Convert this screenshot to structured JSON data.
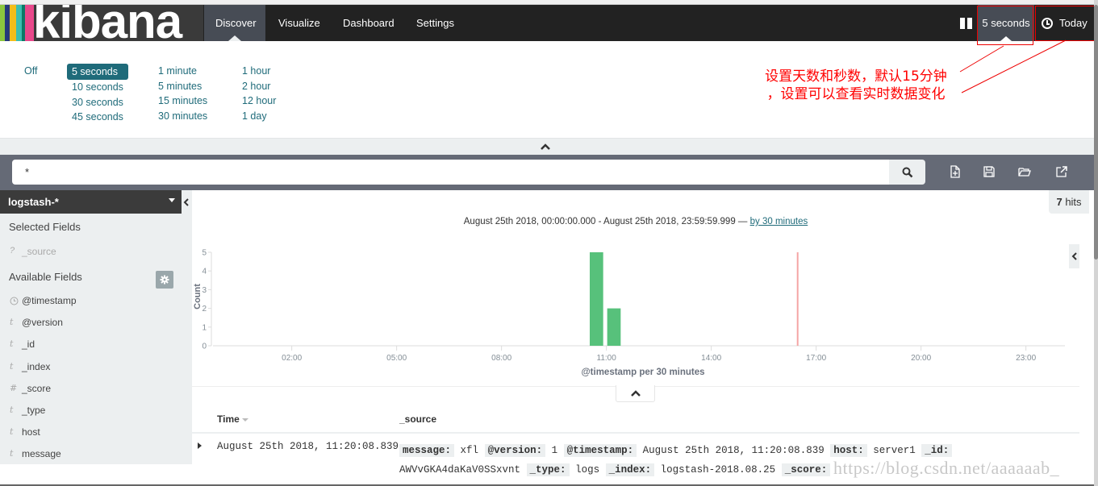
{
  "app": {
    "logo_text": "kibana",
    "logo_stripe_colors": [
      "#8cc63e",
      "#25387b",
      "#f4bd19",
      "#3cbeb1",
      "#0c7a66",
      "#e8488b"
    ]
  },
  "nav": {
    "items": [
      {
        "label": "Discover",
        "active": true
      },
      {
        "label": "Visualize",
        "active": false
      },
      {
        "label": "Dashboard",
        "active": false
      },
      {
        "label": "Settings",
        "active": false
      }
    ],
    "refresh_interval_label": "5 seconds",
    "timepicker_label": "Today"
  },
  "refresh_panel": {
    "columns": [
      [
        "Off"
      ],
      [
        "5 seconds",
        "10 seconds",
        "30 seconds",
        "45 seconds"
      ],
      [
        "1 minute",
        "5 minutes",
        "15 minutes",
        "30 minutes"
      ],
      [
        "1 hour",
        "2 hour",
        "12 hour",
        "1 day"
      ]
    ],
    "selected": "5 seconds"
  },
  "annotation": {
    "line1": "设置天数和秒数，默认15分钟",
    "line2": "，设置可以查看实时数据变化",
    "color": "#ff0000"
  },
  "search": {
    "query": "*"
  },
  "toolbar": {
    "icons": [
      "new-document-icon",
      "save-icon",
      "open-folder-icon",
      "share-icon"
    ]
  },
  "sidebar": {
    "index_pattern": "logstash-*",
    "selected_fields_title": "Selected Fields",
    "selected_fields": [
      {
        "type": "?",
        "name": "_source"
      }
    ],
    "available_fields_title": "Available Fields",
    "available_fields": [
      {
        "type": "clock",
        "name": "@timestamp"
      },
      {
        "type": "t",
        "name": "@version"
      },
      {
        "type": "t",
        "name": "_id"
      },
      {
        "type": "t",
        "name": "_index"
      },
      {
        "type": "#",
        "name": "_score"
      },
      {
        "type": "t",
        "name": "_type"
      },
      {
        "type": "t",
        "name": "host"
      },
      {
        "type": "t",
        "name": "message"
      }
    ]
  },
  "hits": {
    "count": "7",
    "label": "hits"
  },
  "time_range": {
    "text": "August 25th 2018, 00:00:00.000 - August 25th 2018, 23:59:59.999 — ",
    "interval_link": "by 30 minutes"
  },
  "chart_data": {
    "type": "bar",
    "title": "",
    "xlabel": "@timestamp per 30 minutes",
    "ylabel": "Count",
    "x_unit": "hours",
    "xlim": [
      0,
      24
    ],
    "ylim": [
      0,
      5
    ],
    "x_ticks": [
      2,
      5,
      8,
      11,
      14,
      17,
      20,
      23
    ],
    "x_tick_labels": [
      "02:00",
      "05:00",
      "08:00",
      "11:00",
      "14:00",
      "17:00",
      "20:00",
      "23:00"
    ],
    "y_ticks": [
      0,
      1,
      2,
      3,
      4,
      5
    ],
    "bucket_hours": 0.5,
    "bars": [
      {
        "start": 10.5,
        "label": "10:30",
        "value": 5
      },
      {
        "start": 11.0,
        "label": "11:00",
        "value": 2
      }
    ],
    "current_time_marker": 16.47,
    "bar_color": "#57c17b",
    "marker_color": "#f4a5a5",
    "grid": false,
    "legend": "none"
  },
  "table": {
    "columns": [
      "Time",
      "_source"
    ],
    "rows": [
      {
        "time": "August 25th 2018, 11:20:08.839",
        "source": [
          {
            "key": "message:",
            "value": "xfl"
          },
          {
            "key": "@version:",
            "value": "1"
          },
          {
            "key": "@timestamp:",
            "value": "August 25th 2018, 11:20:08.839"
          },
          {
            "key": "host:",
            "value": "server1"
          },
          {
            "key": "_id:",
            "value": "AWVvGKA4daKaV0SSxvnt"
          },
          {
            "key": "_type:",
            "value": "logs"
          },
          {
            "key": "_index:",
            "value": "logstash-2018.08.25"
          },
          {
            "key": "_score:",
            "value": ""
          }
        ]
      }
    ]
  },
  "watermark": "https://blog.csdn.net/aaaaaab_"
}
